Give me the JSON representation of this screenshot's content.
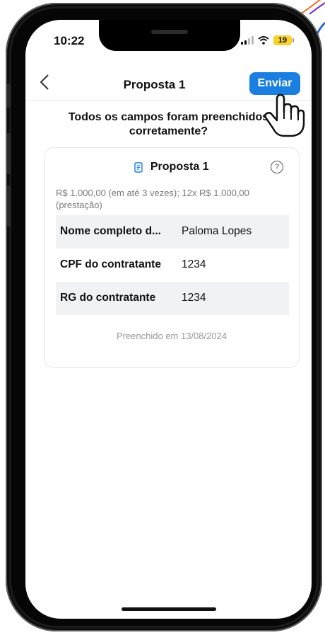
{
  "status_bar": {
    "time": "10:22",
    "battery": "19"
  },
  "nav": {
    "back_icon": "chevron-left-icon",
    "title": "Proposta 1",
    "send_label": "Enviar"
  },
  "question": {
    "line1": "Todos os campos foram preenchidos",
    "line2": "corretamente?"
  },
  "card": {
    "title": "Proposta 1",
    "price": "R$ 1.000,00 (em até 3 vezes); 12x R$ 1.000,00 (prestação)",
    "rows": [
      {
        "key": "Nome completo d...",
        "value": "Paloma Lopes"
      },
      {
        "key": "CPF do contratante",
        "value": "1234"
      },
      {
        "key": "RG do contratante",
        "value": "1234"
      }
    ],
    "filled_at": "Preenchido em 13/08/2024"
  },
  "colors": {
    "accent": "#1a7fe0",
    "battery": "#f5d32c",
    "row_alt": "#f1f2f4"
  }
}
